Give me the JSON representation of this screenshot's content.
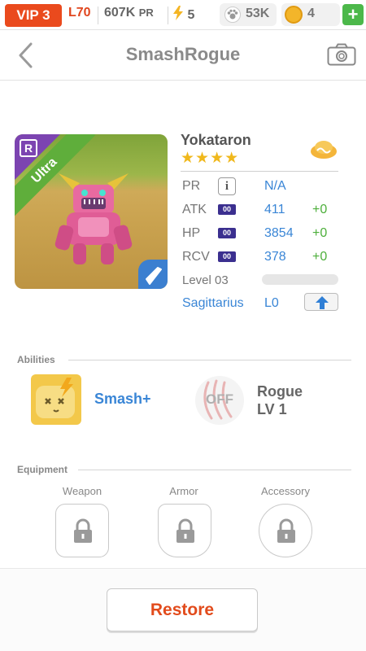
{
  "statusbar": {
    "vip": "VIP 3",
    "level": "L70",
    "pr_value": "607K",
    "pr_unit": "PR",
    "energy": "5",
    "paws": "53K",
    "coins": "4",
    "add": "+"
  },
  "header": {
    "title": "SmashRogue"
  },
  "monster": {
    "name": "Yokataron",
    "stars": "★★★★",
    "rarity_badge": "R",
    "tier": "Ultra",
    "stats": [
      {
        "label": "PR",
        "value": "N/A",
        "bonus": ""
      },
      {
        "label": "ATK",
        "chip": "00",
        "value": "411",
        "bonus": "+0"
      },
      {
        "label": "HP",
        "chip": "00",
        "value": "3854",
        "bonus": "+0"
      },
      {
        "label": "RCV",
        "chip": "00",
        "value": "378",
        "bonus": "+0"
      }
    ],
    "info_icon": "i",
    "level": "Level 03",
    "level_progress": 0.0,
    "zodiac": "Sagittarius",
    "zodiac_level": "L0"
  },
  "abilities": {
    "title": "Abilities",
    "ability1": "Smash+",
    "ability2_state": "OFF",
    "ability2_name": "Rogue",
    "ability2_level": "LV 1"
  },
  "equipment": {
    "title": "Equipment",
    "slots": [
      "Weapon",
      "Armor",
      "Accessory"
    ]
  },
  "footer": {
    "restore": "Restore"
  },
  "colors": {
    "accent": "#e24b1c",
    "link": "#3a86d6",
    "bonus": "#4daf3b",
    "vip": "#ea4a1d",
    "star": "#f0b81c"
  },
  "icons": [
    "back-chevron-icon",
    "camera-icon",
    "lightning-icon",
    "paw-icon",
    "coin-icon",
    "plus-icon",
    "cloud-element-icon",
    "info-icon",
    "arrow-up-icon",
    "lock-icon",
    "smash-ability-icon",
    "claw-icon",
    "rocket-type-icon"
  ]
}
